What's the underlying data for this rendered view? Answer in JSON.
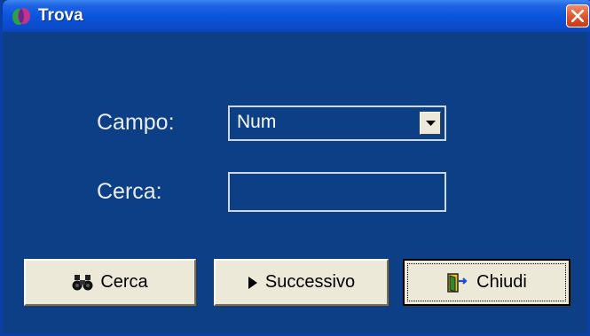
{
  "window": {
    "title": "Trova"
  },
  "form": {
    "campo_label": "Campo:",
    "campo_value": "Num",
    "cerca_label": "Cerca:",
    "cerca_value": ""
  },
  "buttons": {
    "cerca": "Cerca",
    "successivo": "Successivo",
    "chiudi": "Chiudi"
  },
  "icons": {
    "app": "app-logo-icon",
    "close": "close-icon",
    "dropdown": "chevron-down-icon",
    "search": "binoculars-icon",
    "next": "play-arrow-icon",
    "exit": "door-exit-icon"
  },
  "colors": {
    "titlebar": "#0a55dd",
    "client": "#0c3f86",
    "close": "#e0522c",
    "button": "#ece9d8"
  }
}
